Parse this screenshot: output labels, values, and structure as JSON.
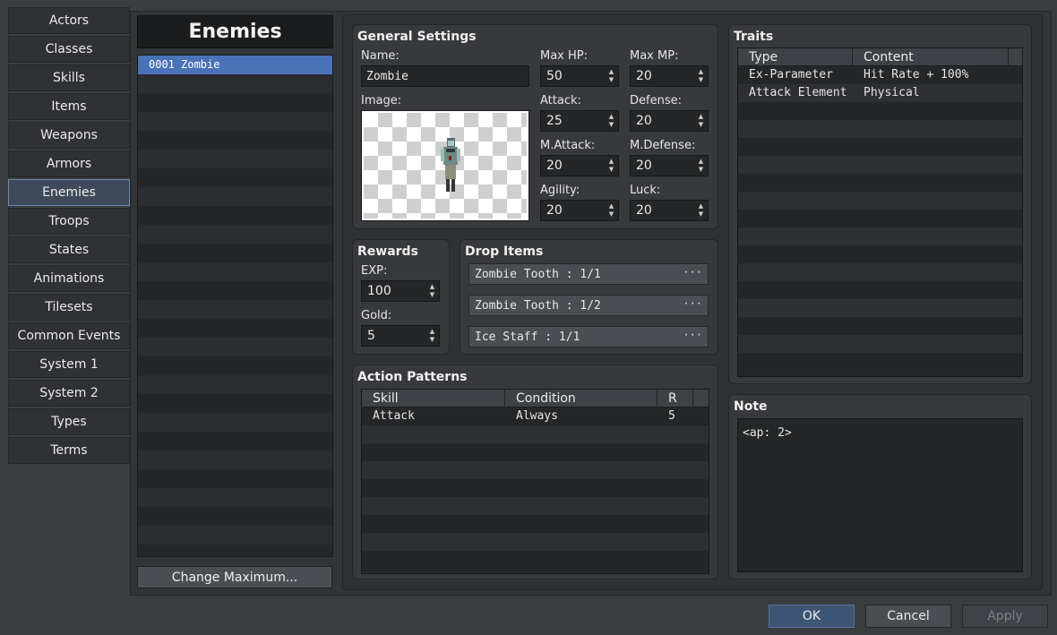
{
  "categories": [
    "Actors",
    "Classes",
    "Skills",
    "Items",
    "Weapons",
    "Armors",
    "Enemies",
    "Troops",
    "States",
    "Animations",
    "Tilesets",
    "Common Events",
    "System 1",
    "System 2",
    "Types",
    "Terms"
  ],
  "selected_category": "Enemies",
  "list": {
    "title": "Enemies",
    "items": [
      "0001 Zombie"
    ],
    "change_maximum_label": "Change Maximum..."
  },
  "general": {
    "title": "General Settings",
    "name_label": "Name:",
    "name_value": "Zombie",
    "image_label": "Image:",
    "max_hp_label": "Max HP:",
    "max_hp": "50",
    "max_mp_label": "Max MP:",
    "max_mp": "20",
    "attack_label": "Attack:",
    "attack": "25",
    "defense_label": "Defense:",
    "defense": "20",
    "mattack_label": "M.Attack:",
    "mattack": "20",
    "mdefense_label": "M.Defense:",
    "mdefense": "20",
    "agility_label": "Agility:",
    "agility": "20",
    "luck_label": "Luck:",
    "luck": "20"
  },
  "rewards": {
    "title": "Rewards",
    "exp_label": "EXP:",
    "exp": "100",
    "gold_label": "Gold:",
    "gold": "5"
  },
  "drops": {
    "title": "Drop Items",
    "items": [
      "Zombie Tooth : 1/1",
      "Zombie Tooth : 1/2",
      "Ice Staff : 1/1"
    ],
    "dots": "···"
  },
  "actions": {
    "title": "Action Patterns",
    "headers": {
      "skill": "Skill",
      "condition": "Condition",
      "r": "R"
    },
    "rows": [
      {
        "skill": "Attack",
        "condition": "Always",
        "r": "5"
      }
    ]
  },
  "traits": {
    "title": "Traits",
    "headers": {
      "type": "Type",
      "content": "Content"
    },
    "rows": [
      {
        "type": "Ex-Parameter",
        "content": "Hit Rate + 100%"
      },
      {
        "type": "Attack Element",
        "content": "Physical"
      }
    ]
  },
  "note": {
    "title": "Note",
    "text": "<ap: 2>"
  },
  "buttons": {
    "ok": "OK",
    "cancel": "Cancel",
    "apply": "Apply"
  },
  "spin_up": "▲",
  "spin_down": "▼",
  "colors": {
    "selection": "#4a72b8",
    "ok_button": "#3d5574"
  },
  "image_preview": {
    "icon": "zombie-sprite"
  }
}
